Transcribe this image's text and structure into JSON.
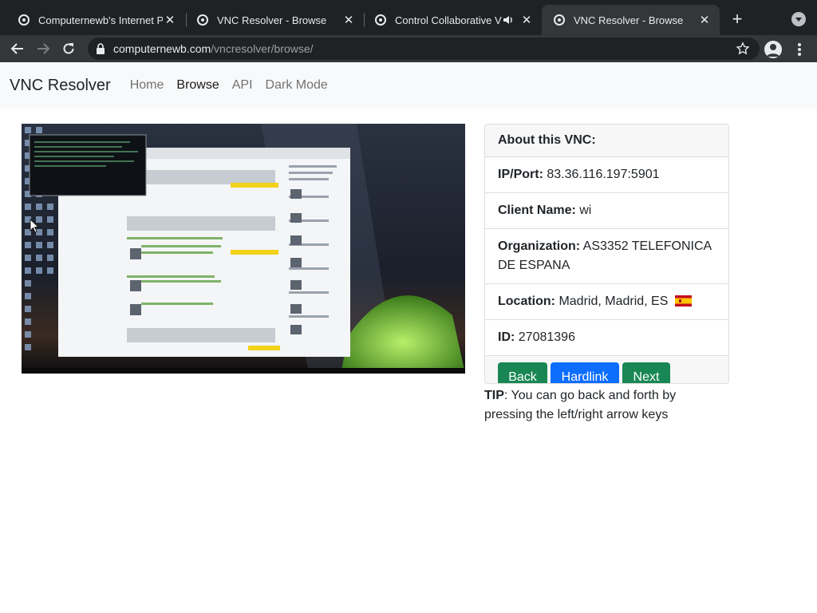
{
  "browser": {
    "tabs": [
      {
        "title": "Computernewb's Internet Pu",
        "active": false
      },
      {
        "title": "VNC Resolver - Browse",
        "active": false
      },
      {
        "title": "Control Collaborative Vi",
        "active": false,
        "audio": true
      },
      {
        "title": "VNC Resolver - Browse",
        "active": true
      }
    ],
    "url_host": "computernewb.com",
    "url_path": "/vncresolver/browse/"
  },
  "navbar": {
    "brand": "VNC Resolver",
    "links": [
      {
        "label": "Home",
        "active": false
      },
      {
        "label": "Browse",
        "active": true
      },
      {
        "label": "API",
        "active": false
      },
      {
        "label": "Dark Mode",
        "active": false
      }
    ]
  },
  "card": {
    "header": "About this VNC:",
    "ip_label": "IP/Port:",
    "ip_value": "83.36.116.197:5901",
    "client_label": "Client Name:",
    "client_value": "wi",
    "org_label": "Organization:",
    "org_value": "AS3352 TELEFONICA DE ESPANA",
    "location_label": "Location:",
    "location_value": "Madrid, Madrid, ES",
    "id_label": "ID:",
    "id_value": "27081396",
    "buttons": {
      "back": "Back",
      "hardlink": "Hardlink",
      "next": "Next"
    }
  },
  "tip": {
    "label": "TIP",
    "text": ": You can go back and forth by pressing the left/right arrow keys"
  },
  "colors": {
    "btn_green": "#198754",
    "btn_blue": "#0d6efd",
    "tabstrip": "#202124",
    "toolbar": "#35363a"
  }
}
